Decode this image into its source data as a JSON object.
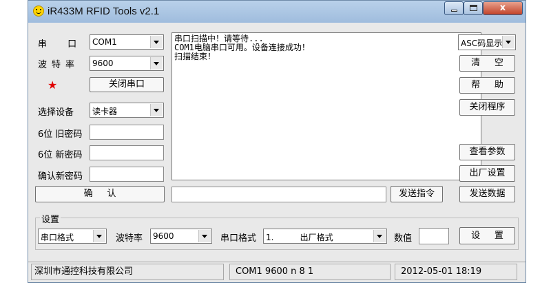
{
  "window": {
    "title": "iR433M RFID Tools v2.1",
    "close_label": "x"
  },
  "left_panel": {
    "port_label": "串 口",
    "port_value": "COM1",
    "baud_label": "波特率",
    "baud_value": "9600",
    "close_port_button": "关闭串口",
    "select_device_label": "选择设备",
    "device_value": "读卡器",
    "old_pwd_label": "6位 旧密码",
    "new_pwd_label": "6位 新密码",
    "confirm_pwd_label": "确认新密码",
    "confirm_button": "确     认"
  },
  "log": {
    "lines": [
      "串口扫描中！请等待...",
      "COM1电脑串口可用。设备连接成功！",
      "扫描结束！"
    ]
  },
  "right_panel": {
    "format_value": "ASC码显示",
    "clear_button": "清     空",
    "help_button": "帮     助",
    "close_program_button": "关闭程序",
    "view_params_button": "查看参数",
    "factory_settings_button": "出厂设置",
    "send_data_button": "发送数据"
  },
  "command": {
    "input_value": "",
    "send_command_button": "发送指令"
  },
  "settings": {
    "group_title": "设置",
    "port_format_value": "串口格式",
    "baud_label": "波特率",
    "baud_value": "9600",
    "port_format_label": "串口格式",
    "format_option_value": "1.          出厂格式",
    "value_label": "数值",
    "value_input": "",
    "set_button": "设     置"
  },
  "status_bar": {
    "company": "深圳市通控科技有限公司",
    "connection": "COM1 9600 n 8 1",
    "datetime": "2012-05-01 18:19"
  }
}
